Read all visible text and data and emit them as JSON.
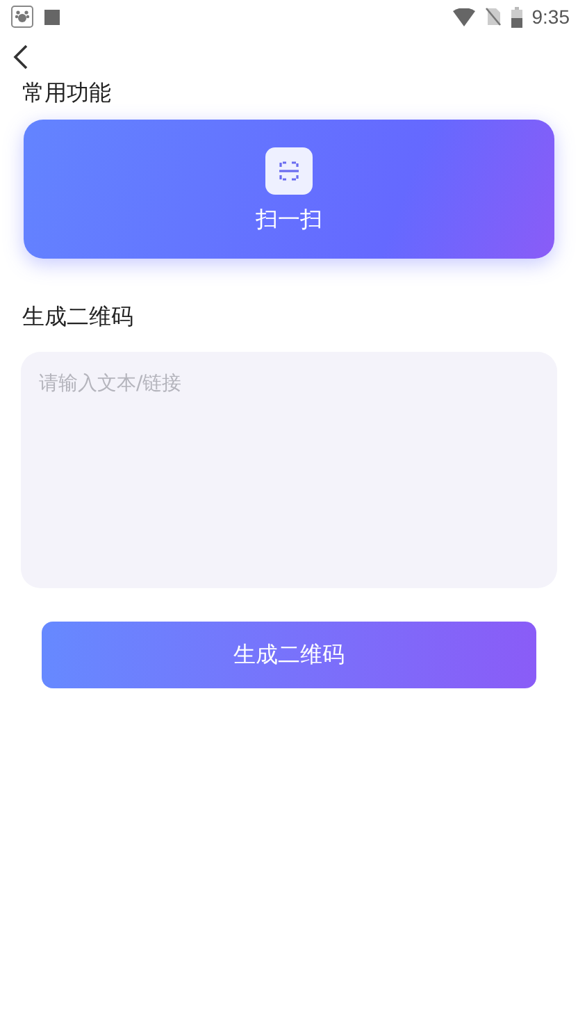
{
  "status_bar": {
    "time": "9:35"
  },
  "sections": [
    {
      "title": "常用功能"
    },
    {
      "title": "生成二维码"
    }
  ],
  "scan_card": {
    "label": "扫一扫"
  },
  "input": {
    "placeholder": "请输入文本/链接"
  },
  "generate_button": {
    "label": "生成二维码"
  }
}
